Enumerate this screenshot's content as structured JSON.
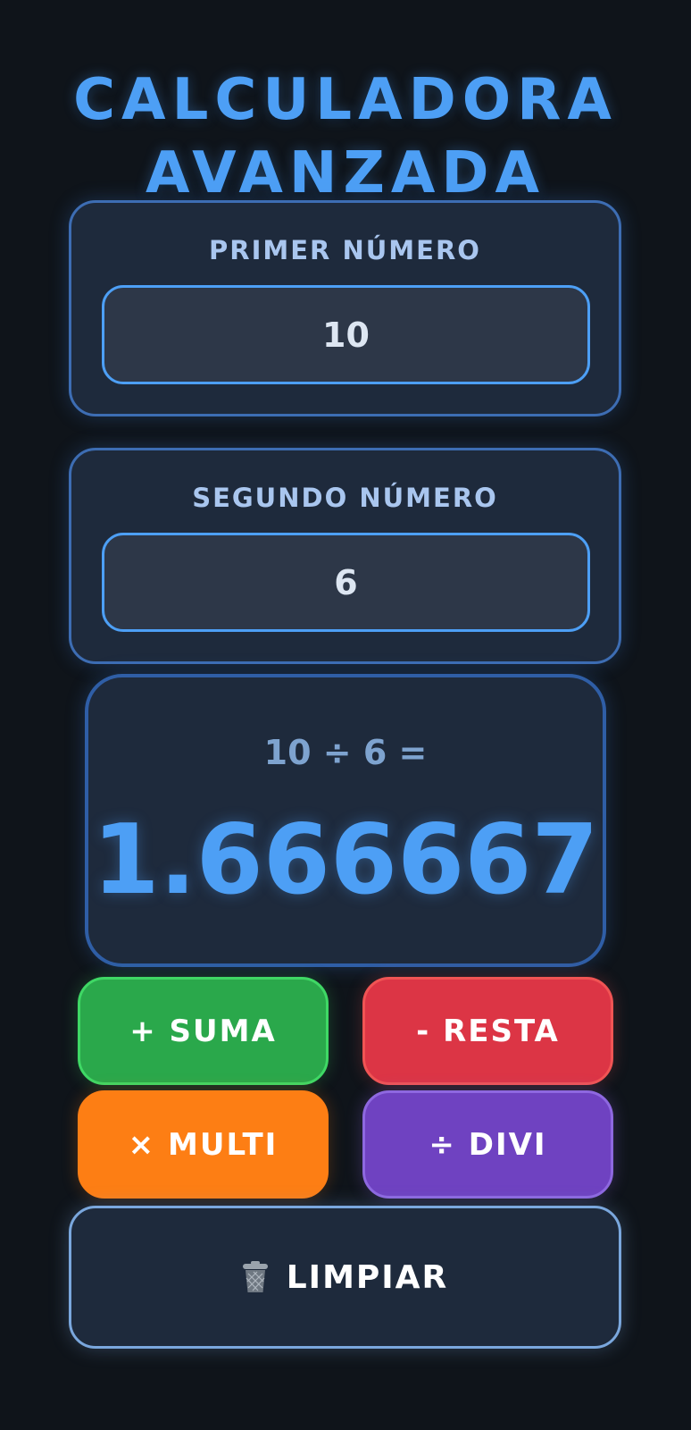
{
  "header": {
    "title_line1": "CALCULADORA",
    "title_line2": "AVANZADA"
  },
  "first_number": {
    "label": "PRIMER NÚMERO",
    "value": "10"
  },
  "second_number": {
    "label": "SEGUNDO NÚMERO",
    "value": "6"
  },
  "result": {
    "expression": "10 ÷ 6 =",
    "value": "1.666667"
  },
  "operations": {
    "add_label": "+ SUMA",
    "subtract_label": "- RESTA",
    "multiply_label": "× MULTI",
    "divide_label": "÷ DIVI"
  },
  "clear": {
    "label": "LIMPIAR",
    "icon": "trash-icon"
  },
  "colors": {
    "accent": "#4d9ff5",
    "add": "#2aa84b",
    "subtract": "#dc3545",
    "multiply": "#fd7e14",
    "divide": "#6f42c1",
    "background": "#0f141a",
    "card": "#1e2a3c"
  }
}
